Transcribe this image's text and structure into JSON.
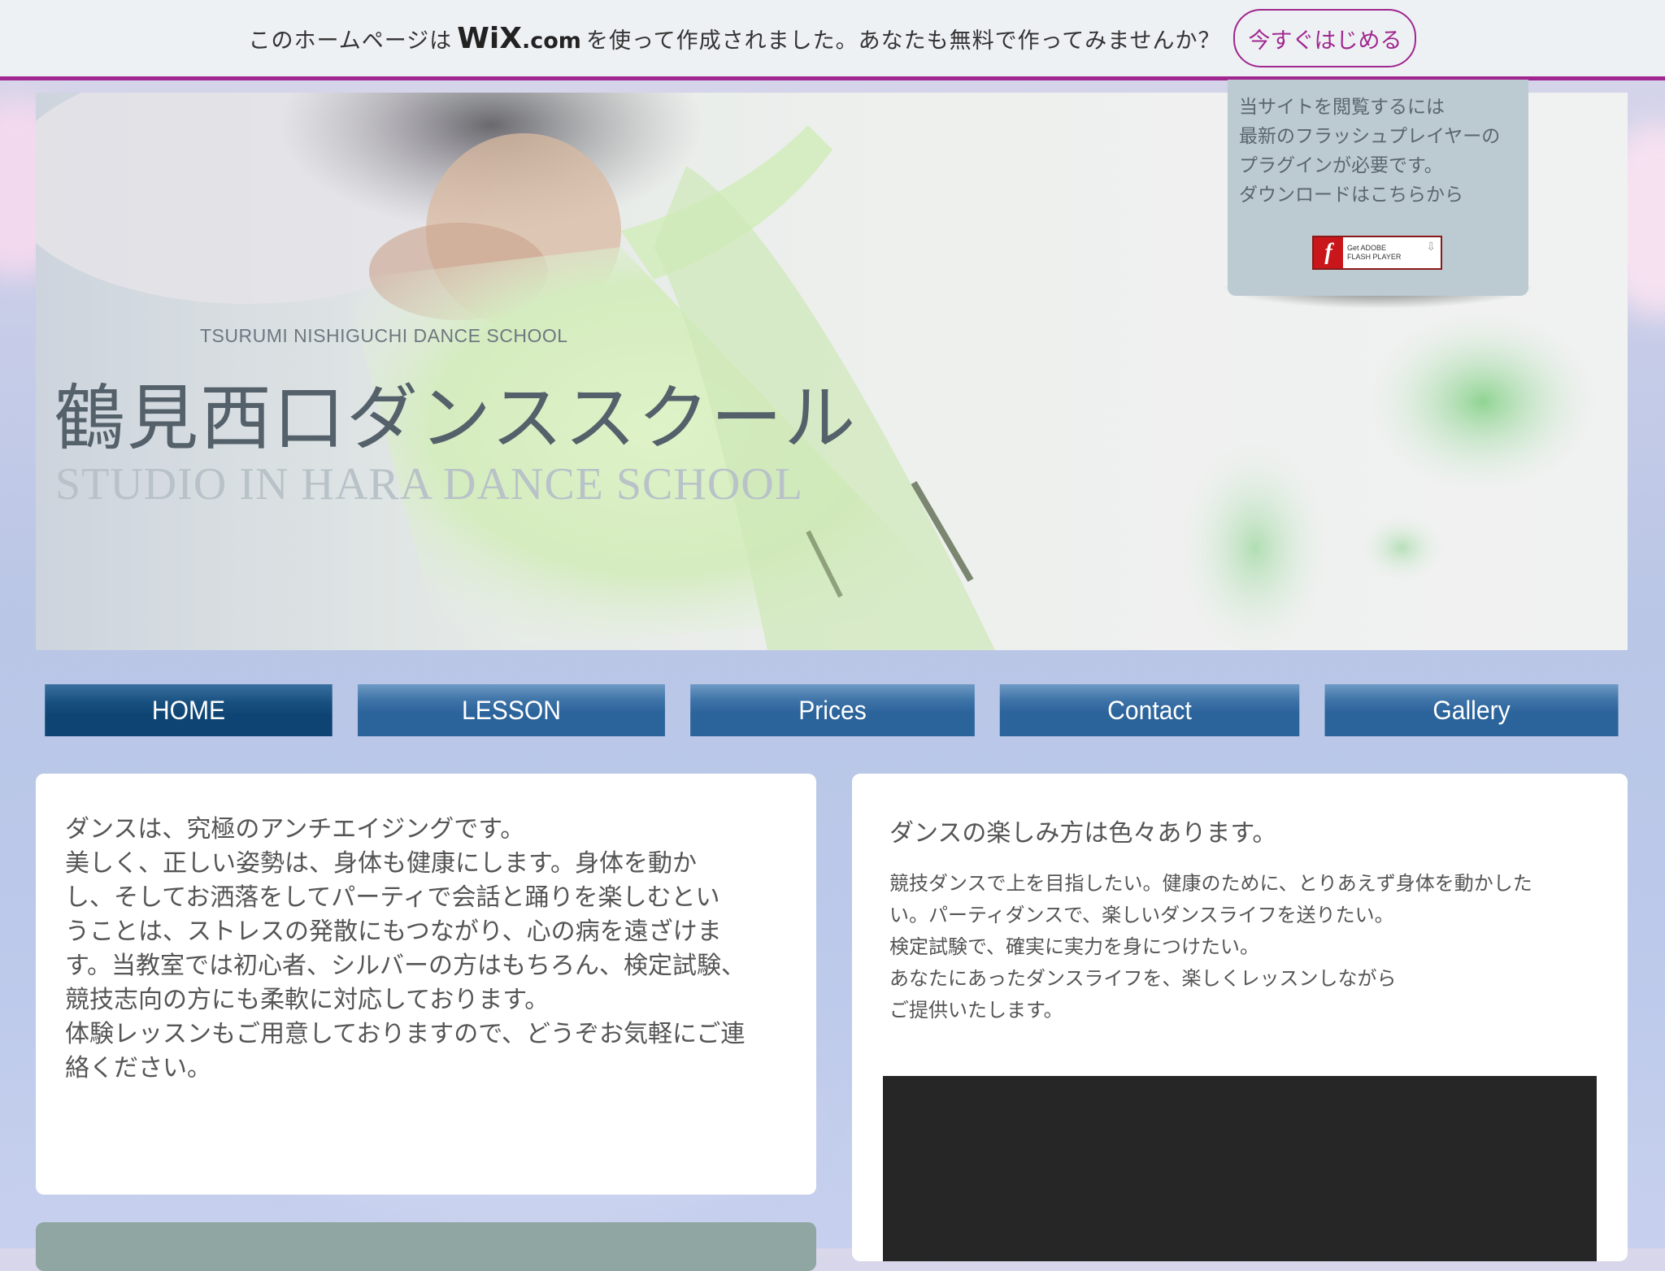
{
  "wix_banner": {
    "text_before": "このホームページは",
    "logo_wix": "WiX",
    "logo_com": ".com",
    "text_after": "を使って作成されました。あなたも無料で作ってみませんか？",
    "cta_label": "今すぐはじめる",
    "accent_color": "#a0278f"
  },
  "hero": {
    "subtitle_en": "TSURUMI NISHIGUCHI DANCE SCHOOL",
    "title": "鶴見西口ダンススクール",
    "title_en": "STUDIO IN HARA DANCE SCHOOL"
  },
  "flash_notice": {
    "lines": [
      "当サイトを閲覧するには",
      "最新のフラッシュプレイヤーの",
      "プラグインが必要です。",
      "ダウンロードはこちらから"
    ],
    "badge_line1": "Get ADOBE",
    "badge_line2": "FLASH PLAYER",
    "badge_icon": "flash-icon"
  },
  "nav": {
    "items": [
      {
        "label": "HOME",
        "active": true
      },
      {
        "label": "LESSON",
        "active": false
      },
      {
        "label": "Prices",
        "active": false
      },
      {
        "label": "Contact",
        "active": false
      },
      {
        "label": "Gallery",
        "active": false
      }
    ],
    "colors": {
      "normal": "#2b639b",
      "active": "#0e4473"
    }
  },
  "left_panel": {
    "lines": [
      "ダンスは、究極のアンチエイジングです。",
      "美しく、正しい姿勢は、身体も健康にします。身体を動か",
      "し、そしてお洒落をしてパーティで会話と踊りを楽しむとい",
      "うことは、ストレスの発散にもつながり、心の病を遠ざけま",
      "す。当教室では初心者、シルバーの方はもちろん、検定試験、",
      "競技志向の方にも柔軟に対応しております。",
      "体験レッスンもご用意しておりますので、どうぞお気軽にご連",
      "絡ください。"
    ]
  },
  "right_panel": {
    "title": "ダンスの楽しみ方は色々あります。",
    "lines": [
      "競技ダンスで上を目指したい。健康のために、とりあえず身体を動かした",
      "い。パーティダンスで、楽しいダンスライフを送りたい。",
      "検定試験で、確実に実力を身につけたい。",
      "あなたにあったダンスライフを、楽しくレッスンしながら",
      "ご提供いたします。"
    ]
  }
}
